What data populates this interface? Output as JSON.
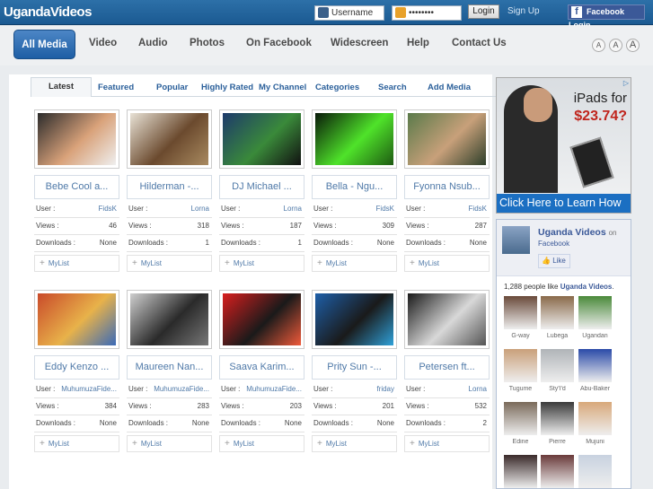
{
  "header": {
    "logo": "UgandaVideos",
    "username_placeholder": "Username",
    "password_value": "••••••••",
    "login_label": "Login",
    "signup_label": "Sign Up",
    "fb_login_label": "Facebook Login"
  },
  "nav": {
    "active": "All Media",
    "items": [
      "Video",
      "Audio",
      "Photos",
      "On Facebook",
      "Widescreen",
      "Help",
      "Contact Us"
    ],
    "font_sizes": [
      "A",
      "A",
      "A"
    ]
  },
  "subtabs": {
    "active": "Latest",
    "items": [
      "Featured",
      "Popular",
      "Highly Rated",
      "My Channel",
      "Categories",
      "Search",
      "Add Media"
    ]
  },
  "labels": {
    "user": "User :",
    "views": "Views :",
    "downloads": "Downloads :",
    "mylist": "MyList"
  },
  "videos": [
    {
      "title": "Bebe Cool a...",
      "user": "FidsK",
      "views": "46",
      "downloads": "None",
      "colors": [
        "#2b2b2b",
        "#d9a27a",
        "#efefef"
      ]
    },
    {
      "title": "Hilderman -...",
      "user": "Lorna",
      "views": "318",
      "downloads": "1",
      "colors": [
        "#e8e2d6",
        "#6b4a2e",
        "#a98a60"
      ]
    },
    {
      "title": "DJ Michael ...",
      "user": "Lorna",
      "views": "187",
      "downloads": "1",
      "colors": [
        "#1d3a6b",
        "#3a8a3a",
        "#111"
      ]
    },
    {
      "title": "Bella - Ngu...",
      "user": "FidsK",
      "views": "309",
      "downloads": "None",
      "colors": [
        "#0a1a0a",
        "#4fe32a",
        "#1e5a12"
      ]
    },
    {
      "title": "Fyonna Nsub...",
      "user": "FidsK",
      "views": "287",
      "downloads": "None",
      "colors": [
        "#5a7a4a",
        "#c8a07a",
        "#2e3f2a"
      ]
    },
    {
      "title": "Eddy Kenzo ...",
      "user": "MuhumuzaFide...",
      "views": "384",
      "downloads": "None",
      "colors": [
        "#c94a2a",
        "#e8b24a",
        "#3a6ab8"
      ]
    },
    {
      "title": "Maureen Nan...",
      "user": "MuhumuzaFide...",
      "views": "283",
      "downloads": "None",
      "colors": [
        "#cfcfcf",
        "#2a2a2a",
        "#777"
      ]
    },
    {
      "title": "Saava Karim...",
      "user": "MuhumuzaFide...",
      "views": "203",
      "downloads": "None",
      "colors": [
        "#d81e1e",
        "#1a1a1a",
        "#f05a3a"
      ]
    },
    {
      "title": "Prity Sun -...",
      "user": "friday",
      "views": "201",
      "downloads": "None",
      "colors": [
        "#1e5fa8",
        "#1a1a1a",
        "#2fa0d8"
      ]
    },
    {
      "title": "Petersen ft...",
      "user": "Lorna",
      "views": "532",
      "downloads": "2",
      "colors": [
        "#1a1a1a",
        "#d8d8d8",
        "#555"
      ]
    }
  ],
  "ad": {
    "line1": "iPads for",
    "line2": "$23.74?",
    "cta": "Click Here to Learn How"
  },
  "facebook": {
    "page_name": "Uganda Videos",
    "on": "on",
    "sub": "Facebook",
    "like_label": "Like",
    "count_prefix": "1,288 people like",
    "count_page": "Uganda Videos",
    "fans": [
      {
        "name": "G-way",
        "color": "#6a4a3a"
      },
      {
        "name": "Lubega",
        "color": "#8a6a4a"
      },
      {
        "name": "Ugandan",
        "color": "#4a8a3a"
      },
      {
        "name": "Tugume",
        "color": "#c9a07a"
      },
      {
        "name": "Sty'I'd",
        "color": "#b0b4b8"
      },
      {
        "name": "Abu-Baker",
        "color": "#2a4aa8"
      },
      {
        "name": "Edine",
        "color": "#7a6a5a"
      },
      {
        "name": "Pierre",
        "color": "#3a3a3a"
      },
      {
        "name": "Mujuni",
        "color": "#d8a87a"
      },
      {
        "name": "",
        "color": "#3a2a2a"
      },
      {
        "name": "",
        "color": "#6a3a3a"
      },
      {
        "name": "",
        "color": "#c8d2e0"
      }
    ]
  }
}
